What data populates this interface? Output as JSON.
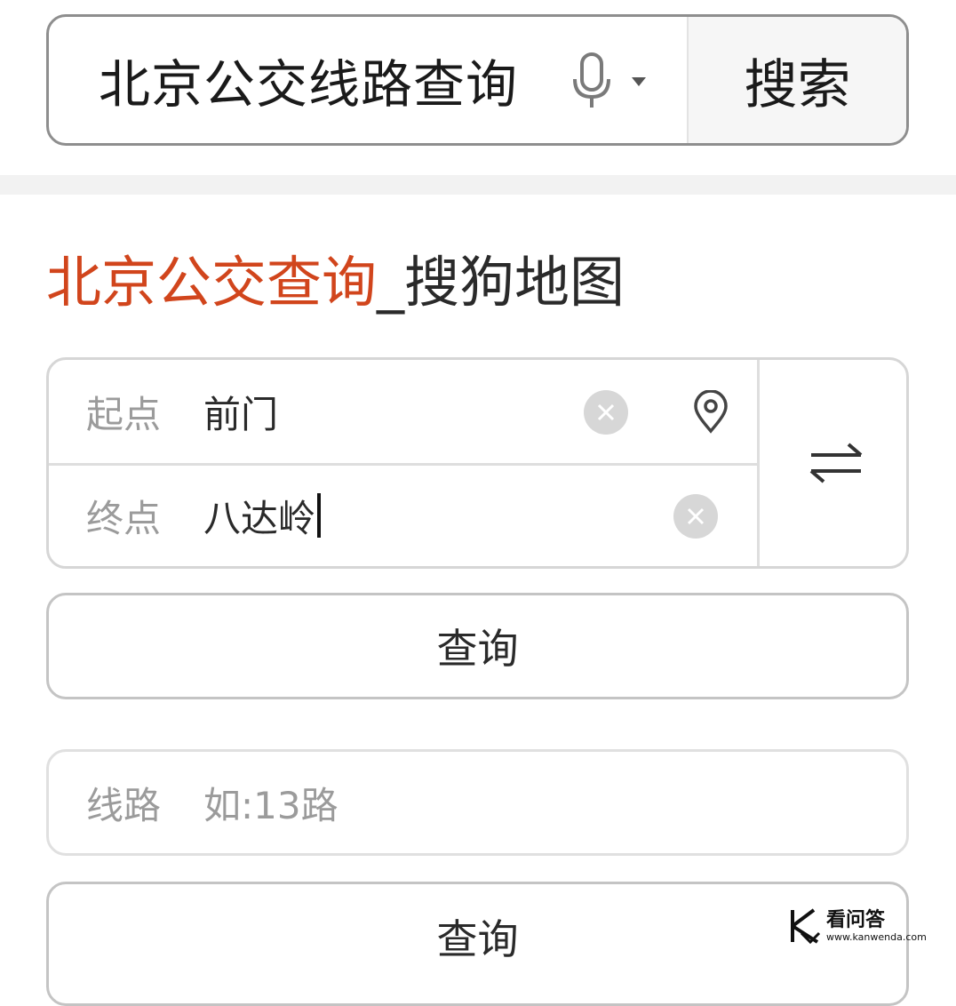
{
  "search": {
    "query": "北京公交线路查询",
    "button_label": "搜索"
  },
  "result": {
    "title_highlight": "北京公交查询",
    "title_rest": "_搜狗地图"
  },
  "route": {
    "start_label": "起点",
    "start_value": "前门",
    "end_label": "终点",
    "end_value": "八达岭"
  },
  "query_button_label": "查询",
  "line_search": {
    "label": "线路",
    "placeholder": "如:13路",
    "button_label": "查询"
  },
  "watermark": {
    "name": "看问答",
    "url": "www.kanwenda.com"
  },
  "icons": {
    "mic": "microphone-icon",
    "dropdown": "caret-down-icon",
    "clear": "clear-icon",
    "location": "location-pin-icon",
    "swap": "swap-icon"
  },
  "colors": {
    "highlight": "#d1451c",
    "border": "#8e8e8e"
  }
}
